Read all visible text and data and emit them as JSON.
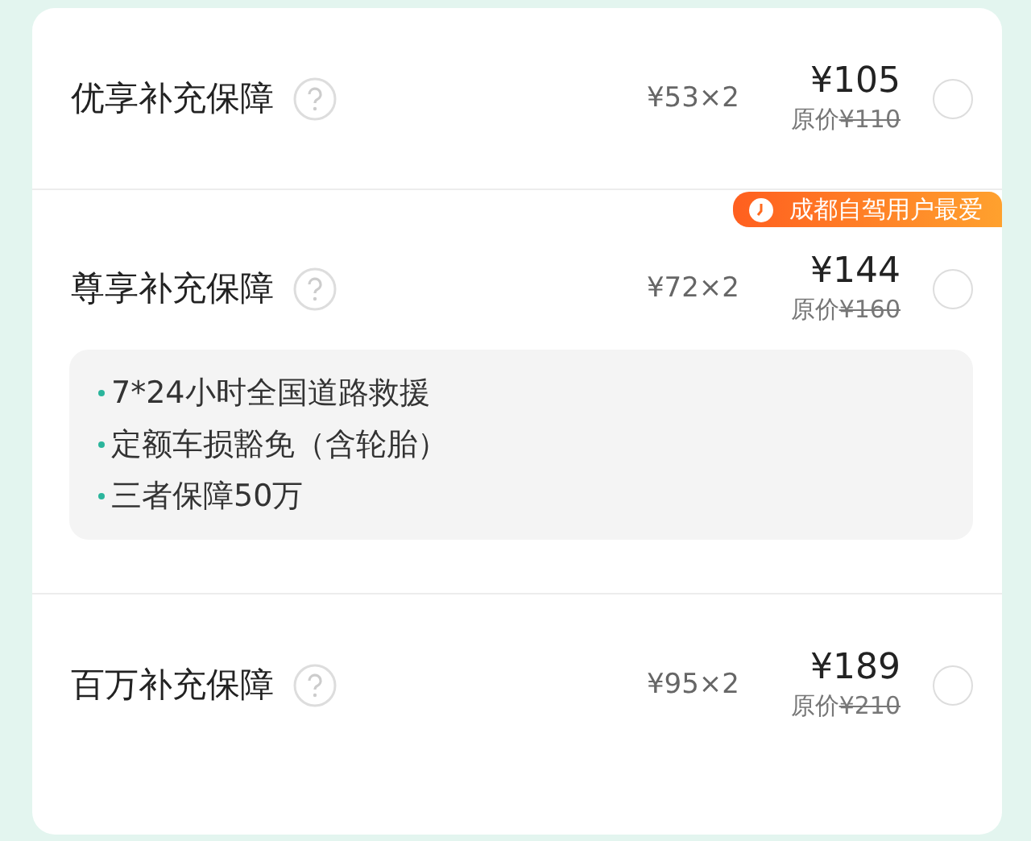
{
  "plans": [
    {
      "name": "优享补充保障",
      "unit_price": "¥53×2",
      "price": "¥105",
      "original_label": "原价",
      "original_price": "¥110",
      "selected": false
    },
    {
      "name": "尊享补充保障",
      "unit_price": "¥72×2",
      "price": "¥144",
      "original_label": "原价",
      "original_price": "¥160",
      "selected": false,
      "badge": "成都自驾用户最爱",
      "features": [
        "7*24小时全国道路救援",
        "定额车损豁免（含轮胎）",
        "三者保障50万"
      ]
    },
    {
      "name": "百万补充保障",
      "unit_price": "¥95×2",
      "price": "¥189",
      "original_label": "原价",
      "original_price": "¥210",
      "selected": false
    }
  ]
}
